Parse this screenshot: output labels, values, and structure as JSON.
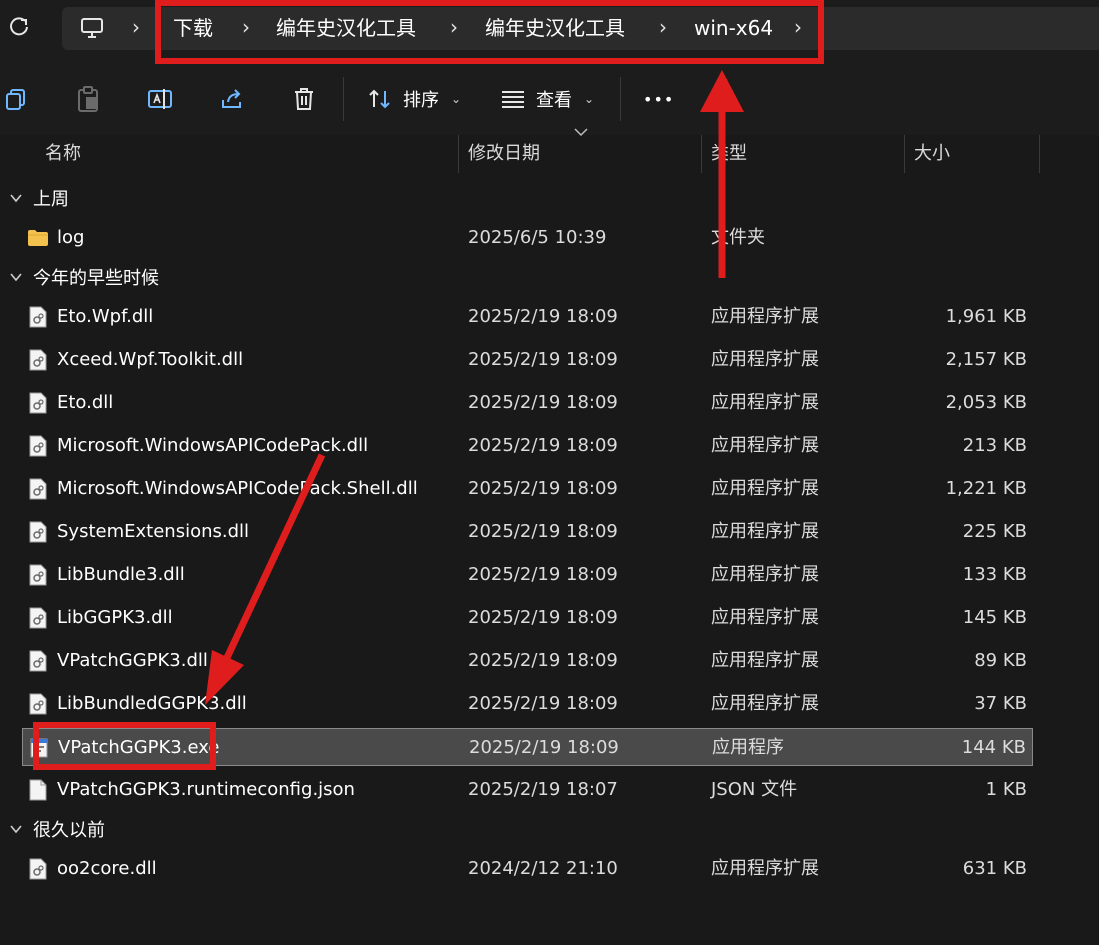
{
  "breadcrumb": {
    "items": [
      "下载",
      "编年史汉化工具",
      "编年史汉化工具",
      "win-x64"
    ]
  },
  "toolbar": {
    "sort_label": "排序",
    "view_label": "查看",
    "more_label": "•••"
  },
  "columns": {
    "name": "名称",
    "date": "修改日期",
    "type": "类型",
    "size": "大小"
  },
  "groups": {
    "last_week": "上周",
    "earlier_this_year": "今年的早些时候",
    "long_ago": "很久以前"
  },
  "files": [
    {
      "name": "log",
      "date": "2025/6/5 10:39",
      "type": "文件夹",
      "size": "",
      "icon": "folder"
    },
    {
      "name": "Eto.Wpf.dll",
      "date": "2025/2/19 18:09",
      "type": "应用程序扩展",
      "size": "1,961 KB",
      "icon": "dll"
    },
    {
      "name": "Xceed.Wpf.Toolkit.dll",
      "date": "2025/2/19 18:09",
      "type": "应用程序扩展",
      "size": "2,157 KB",
      "icon": "dll"
    },
    {
      "name": "Eto.dll",
      "date": "2025/2/19 18:09",
      "type": "应用程序扩展",
      "size": "2,053 KB",
      "icon": "dll"
    },
    {
      "name": "Microsoft.WindowsAPICodePack.dll",
      "date": "2025/2/19 18:09",
      "type": "应用程序扩展",
      "size": "213 KB",
      "icon": "dll"
    },
    {
      "name": "Microsoft.WindowsAPICodePack.Shell.dll",
      "date": "2025/2/19 18:09",
      "type": "应用程序扩展",
      "size": "1,221 KB",
      "icon": "dll"
    },
    {
      "name": "SystemExtensions.dll",
      "date": "2025/2/19 18:09",
      "type": "应用程序扩展",
      "size": "225 KB",
      "icon": "dll"
    },
    {
      "name": "LibBundle3.dll",
      "date": "2025/2/19 18:09",
      "type": "应用程序扩展",
      "size": "133 KB",
      "icon": "dll"
    },
    {
      "name": "LibGGPK3.dll",
      "date": "2025/2/19 18:09",
      "type": "应用程序扩展",
      "size": "145 KB",
      "icon": "dll"
    },
    {
      "name": "VPatchGGPK3.dll",
      "date": "2025/2/19 18:09",
      "type": "应用程序扩展",
      "size": "89 KB",
      "icon": "dll"
    },
    {
      "name": "LibBundledGGPK3.dll",
      "date": "2025/2/19 18:09",
      "type": "应用程序扩展",
      "size": "37 KB",
      "icon": "dll"
    },
    {
      "name": "VPatchGGPK3.exe",
      "date": "2025/2/19 18:09",
      "type": "应用程序",
      "size": "144 KB",
      "icon": "exe",
      "selected": true
    },
    {
      "name": "VPatchGGPK3.runtimeconfig.json",
      "date": "2025/2/19 18:07",
      "type": "JSON 文件",
      "size": "1 KB",
      "icon": "json"
    },
    {
      "name": "oo2core.dll",
      "date": "2024/2/12 21:10",
      "type": "应用程序扩展",
      "size": "631 KB",
      "icon": "dll"
    }
  ],
  "colors": {
    "annotation_red": "#e01d1d",
    "background": "#191919",
    "selected_row": "#4a4a4a"
  }
}
